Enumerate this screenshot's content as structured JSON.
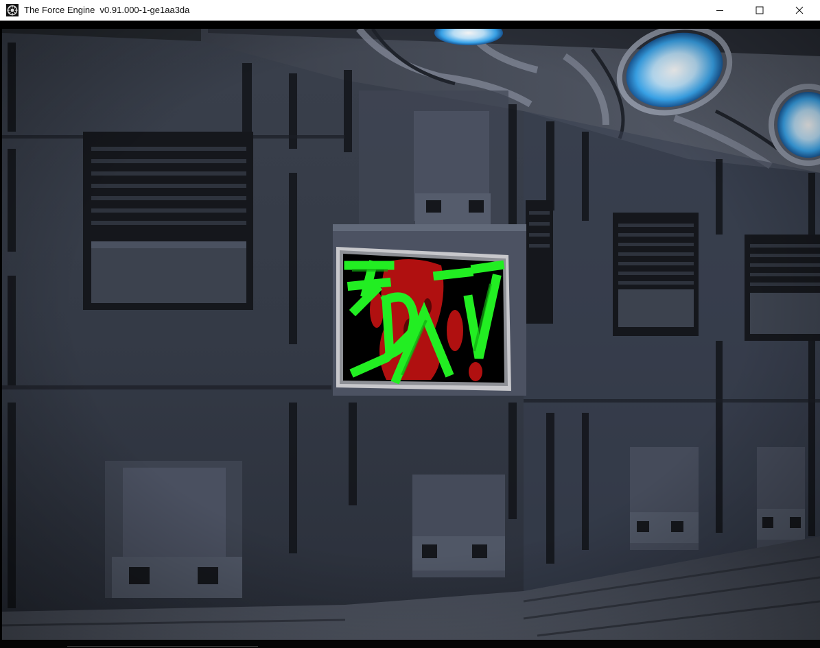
{
  "window": {
    "title": "The Force Engine  v0.91.000-1-ge1aa3da",
    "app_icon": "tfe-logo-icon",
    "controls": {
      "minimize": "minimize-icon",
      "maximize": "maximize-icon",
      "close": "close-icon"
    }
  },
  "scene": {
    "description_icons": {
      "ceiling": "ceiling-lights",
      "wall": "metal-wall-panels",
      "sign": "graffiti-sign",
      "floor": "metal-floor"
    },
    "colors": {
      "wall_base": "#3a404c",
      "wall_dark": "#1a1d24",
      "ceiling_light": "#7ec8ff",
      "sign_green": "#22ee22",
      "sign_red": "#b01010",
      "sign_frame": "#c8c8cc"
    }
  }
}
